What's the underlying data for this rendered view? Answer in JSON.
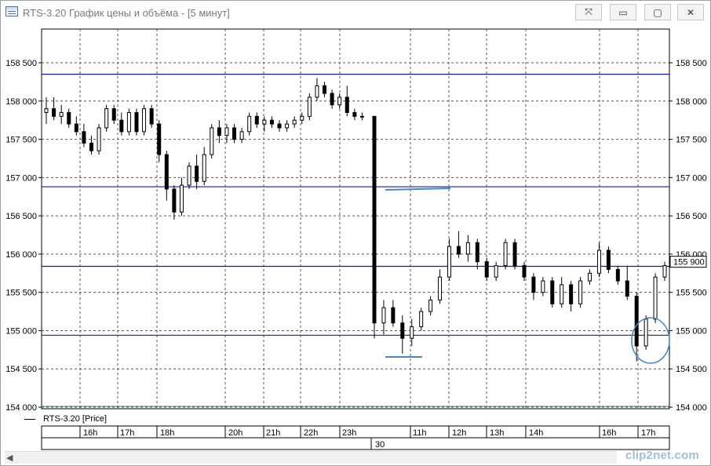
{
  "window": {
    "title": "RTS-3.20 График цены и объёма - [5 минут]",
    "buttons": {
      "tools": "⤧",
      "minimize": "▭",
      "maximize": "▢",
      "close": "✕"
    }
  },
  "chart_data": {
    "type": "candlestick",
    "symbol": "RTS-3.20",
    "legend": "RTS-3.20 [Price]",
    "price_label": "155 900",
    "ylim": [
      154000,
      158900
    ],
    "y_ticks": [
      "158 500",
      "158 000",
      "157 500",
      "157 000",
      "156 500",
      "156 000",
      "155 500",
      "155 000",
      "154 500",
      "154 000"
    ],
    "y_tick_values": [
      158500,
      158000,
      157500,
      157000,
      156500,
      156000,
      155500,
      155000,
      154500,
      154000
    ],
    "x_ticks": [
      "16h",
      "17h",
      "18h",
      "20h",
      "21h",
      "22h",
      "23h",
      "11h",
      "12h",
      "13h",
      "14h",
      "16h",
      "17h"
    ],
    "date_label": "30",
    "horizontal_lines": [
      158350,
      156880,
      155840,
      154940
    ],
    "grid": true,
    "candles": [
      {
        "o": 157850,
        "h": 158050,
        "l": 157700,
        "c": 157900
      },
      {
        "o": 157900,
        "h": 158050,
        "l": 157750,
        "c": 157800
      },
      {
        "o": 157800,
        "h": 157950,
        "l": 157700,
        "c": 157850
      },
      {
        "o": 157850,
        "h": 157900,
        "l": 157650,
        "c": 157700
      },
      {
        "o": 157700,
        "h": 157800,
        "l": 157550,
        "c": 157600
      },
      {
        "o": 157600,
        "h": 157700,
        "l": 157400,
        "c": 157450
      },
      {
        "o": 157450,
        "h": 157550,
        "l": 157300,
        "c": 157350
      },
      {
        "o": 157350,
        "h": 157700,
        "l": 157300,
        "c": 157650
      },
      {
        "o": 157650,
        "h": 157950,
        "l": 157600,
        "c": 157900
      },
      {
        "o": 157900,
        "h": 157950,
        "l": 157700,
        "c": 157750
      },
      {
        "o": 157750,
        "h": 157850,
        "l": 157550,
        "c": 157600
      },
      {
        "o": 157600,
        "h": 157900,
        "l": 157550,
        "c": 157850
      },
      {
        "o": 157850,
        "h": 157900,
        "l": 157550,
        "c": 157600
      },
      {
        "o": 157600,
        "h": 157950,
        "l": 157550,
        "c": 157900
      },
      {
        "o": 157900,
        "h": 157950,
        "l": 157650,
        "c": 157700
      },
      {
        "o": 157700,
        "h": 157750,
        "l": 157200,
        "c": 157300
      },
      {
        "o": 157300,
        "h": 157350,
        "l": 156700,
        "c": 156850
      },
      {
        "o": 156850,
        "h": 156900,
        "l": 156450,
        "c": 156550
      },
      {
        "o": 156550,
        "h": 157000,
        "l": 156500,
        "c": 156900
      },
      {
        "o": 156900,
        "h": 157200,
        "l": 156850,
        "c": 157150
      },
      {
        "o": 157150,
        "h": 157300,
        "l": 156850,
        "c": 156950
      },
      {
        "o": 156950,
        "h": 157400,
        "l": 156900,
        "c": 157300
      },
      {
        "o": 157300,
        "h": 157700,
        "l": 157250,
        "c": 157650
      },
      {
        "o": 157650,
        "h": 157750,
        "l": 157450,
        "c": 157550
      },
      {
        "o": 157550,
        "h": 157700,
        "l": 157450,
        "c": 157650
      },
      {
        "o": 157650,
        "h": 157700,
        "l": 157450,
        "c": 157500
      },
      {
        "o": 157500,
        "h": 157650,
        "l": 157450,
        "c": 157600
      },
      {
        "o": 157600,
        "h": 157850,
        "l": 157550,
        "c": 157800
      },
      {
        "o": 157800,
        "h": 157850,
        "l": 157650,
        "c": 157700
      },
      {
        "o": 157700,
        "h": 157800,
        "l": 157600,
        "c": 157750
      },
      {
        "o": 157750,
        "h": 157800,
        "l": 157650,
        "c": 157700
      },
      {
        "o": 157700,
        "h": 157750,
        "l": 157600,
        "c": 157650
      },
      {
        "o": 157650,
        "h": 157750,
        "l": 157600,
        "c": 157700
      },
      {
        "o": 157700,
        "h": 157800,
        "l": 157650,
        "c": 157750
      },
      {
        "o": 157750,
        "h": 157850,
        "l": 157700,
        "c": 157800
      },
      {
        "o": 157800,
        "h": 158100,
        "l": 157750,
        "c": 158050
      },
      {
        "o": 158050,
        "h": 158300,
        "l": 158000,
        "c": 158200
      },
      {
        "o": 158200,
        "h": 158250,
        "l": 158050,
        "c": 158100
      },
      {
        "o": 158100,
        "h": 158150,
        "l": 157900,
        "c": 157950
      },
      {
        "o": 157950,
        "h": 158100,
        "l": 157900,
        "c": 158050
      },
      {
        "o": 158050,
        "h": 158200,
        "l": 157800,
        "c": 157850
      },
      {
        "o": 157850,
        "h": 157900,
        "l": 157750,
        "c": 157800
      },
      {
        "o": 157800,
        "h": 157850,
        "l": 157750,
        "c": 157800
      },
      {
        "o": 157800,
        "h": 157800,
        "l": 154900,
        "c": 155100
      },
      {
        "o": 155100,
        "h": 155400,
        "l": 154950,
        "c": 155300
      },
      {
        "o": 155300,
        "h": 155400,
        "l": 155050,
        "c": 155100
      },
      {
        "o": 155100,
        "h": 155200,
        "l": 154700,
        "c": 154900
      },
      {
        "o": 154900,
        "h": 155150,
        "l": 154800,
        "c": 155050
      },
      {
        "o": 155050,
        "h": 155300,
        "l": 155000,
        "c": 155250
      },
      {
        "o": 155250,
        "h": 155450,
        "l": 155200,
        "c": 155400
      },
      {
        "o": 155400,
        "h": 155800,
        "l": 155350,
        "c": 155700
      },
      {
        "o": 155700,
        "h": 156200,
        "l": 155650,
        "c": 156100
      },
      {
        "o": 156100,
        "h": 156300,
        "l": 155950,
        "c": 156000
      },
      {
        "o": 156000,
        "h": 156250,
        "l": 155900,
        "c": 156150
      },
      {
        "o": 156150,
        "h": 156200,
        "l": 155800,
        "c": 155900
      },
      {
        "o": 155900,
        "h": 155950,
        "l": 155650,
        "c": 155700
      },
      {
        "o": 155700,
        "h": 155900,
        "l": 155650,
        "c": 155850
      },
      {
        "o": 155850,
        "h": 156200,
        "l": 155800,
        "c": 156150
      },
      {
        "o": 156150,
        "h": 156200,
        "l": 155800,
        "c": 155850
      },
      {
        "o": 155850,
        "h": 155900,
        "l": 155650,
        "c": 155700
      },
      {
        "o": 155700,
        "h": 155750,
        "l": 155400,
        "c": 155500
      },
      {
        "o": 155500,
        "h": 155700,
        "l": 155450,
        "c": 155650
      },
      {
        "o": 155650,
        "h": 155700,
        "l": 155300,
        "c": 155350
      },
      {
        "o": 155350,
        "h": 155700,
        "l": 155300,
        "c": 155600
      },
      {
        "o": 155600,
        "h": 155650,
        "l": 155250,
        "c": 155350
      },
      {
        "o": 155350,
        "h": 155700,
        "l": 155300,
        "c": 155650
      },
      {
        "o": 155650,
        "h": 155800,
        "l": 155600,
        "c": 155750
      },
      {
        "o": 155750,
        "h": 156150,
        "l": 155700,
        "c": 156050
      },
      {
        "o": 156050,
        "h": 156100,
        "l": 155750,
        "c": 155800
      },
      {
        "o": 155800,
        "h": 155850,
        "l": 155600,
        "c": 155650
      },
      {
        "o": 155650,
        "h": 155850,
        "l": 155400,
        "c": 155450
      },
      {
        "o": 155450,
        "h": 155500,
        "l": 154600,
        "c": 154800
      },
      {
        "o": 154800,
        "h": 155200,
        "l": 154750,
        "c": 155150
      },
      {
        "o": 155150,
        "h": 155750,
        "l": 155100,
        "c": 155700
      },
      {
        "o": 155700,
        "h": 155900,
        "l": 155650,
        "c": 155850
      }
    ]
  }
}
